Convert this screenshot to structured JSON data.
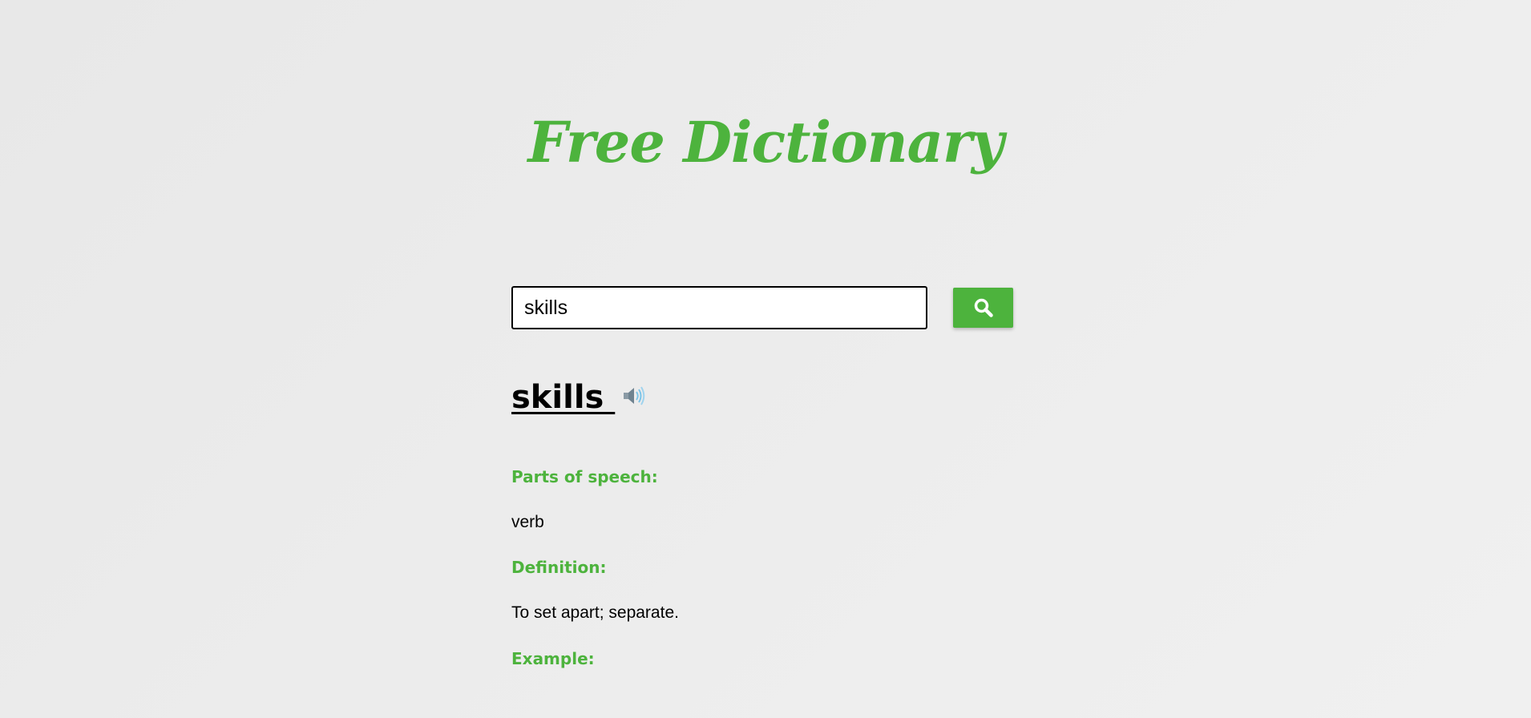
{
  "app": {
    "title": "Free Dictionary"
  },
  "search": {
    "value": "skills",
    "button_icon": "search-icon"
  },
  "result": {
    "word": "skills ",
    "audio_icon": "speaker-icon",
    "parts_of_speech_label": "Parts of speech:",
    "parts_of_speech_value": "verb",
    "definition_label": "Definition:",
    "definition_value": "To set apart; separate.",
    "example_label": "Example:"
  },
  "colors": {
    "accent": "#4db33d",
    "text": "#000000",
    "background": "#ebebeb"
  }
}
